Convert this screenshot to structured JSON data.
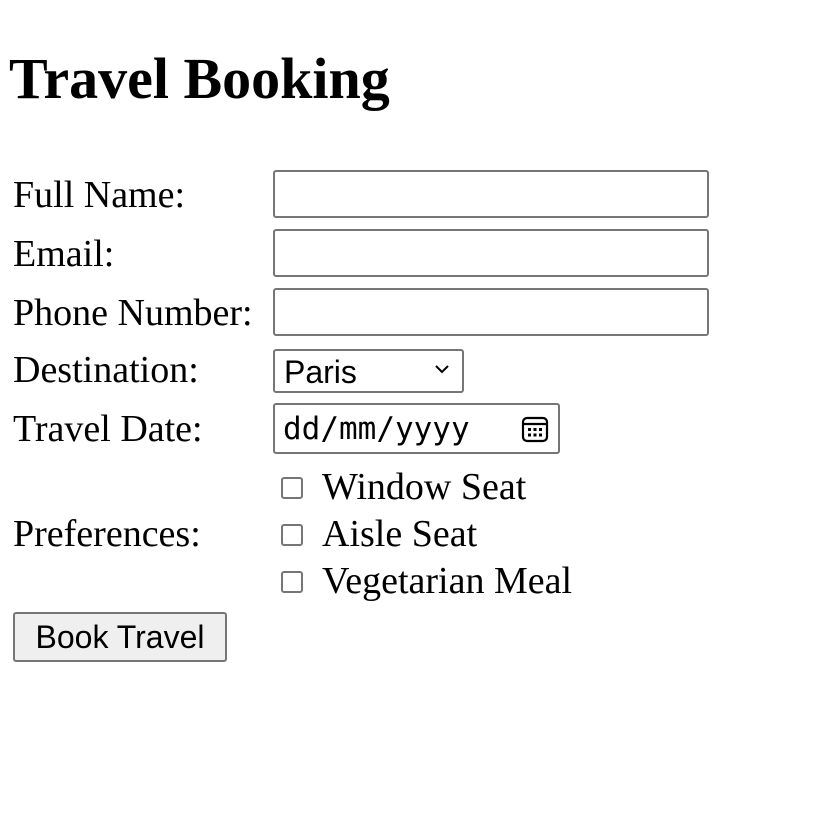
{
  "page": {
    "title": "Travel Booking"
  },
  "form": {
    "full_name": {
      "label": "Full Name:",
      "value": ""
    },
    "email": {
      "label": "Email:",
      "value": ""
    },
    "phone": {
      "label": "Phone Number:",
      "value": ""
    },
    "destination": {
      "label": "Destination:",
      "selected": "Paris"
    },
    "travel_date": {
      "label": "Travel Date:",
      "placeholder": "dd/mm/yyyy"
    },
    "preferences": {
      "label": "Preferences:",
      "options": [
        {
          "label": "Window Seat",
          "checked": false
        },
        {
          "label": "Aisle Seat",
          "checked": false
        },
        {
          "label": "Vegetarian Meal",
          "checked": false
        }
      ]
    },
    "submit_label": "Book Travel"
  },
  "icons": {
    "destination_dropdown": "chevron-down-icon",
    "date_picker": "calendar-icon"
  },
  "colors": {
    "border": "#767676",
    "button_background": "#efefef",
    "text": "#000000",
    "background": "#ffffff"
  }
}
